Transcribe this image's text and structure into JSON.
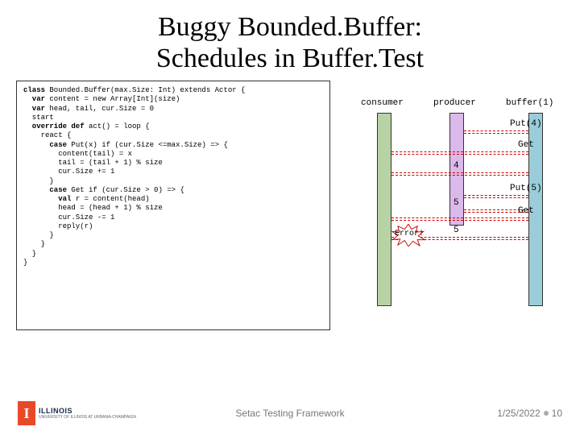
{
  "title_line1": "Buggy Bounded.Buffer:",
  "title_line2": "Schedules in Buffer.Test",
  "code": {
    "l1a": "class ",
    "l1b": "Bounded.Buffer(max.Size: Int) extends Actor {",
    "l2a": "  var ",
    "l2b": "content = new Array[Int](size)",
    "l3a": "  var ",
    "l3b": "head, tail, cur.Size = 0",
    "l4": "  start",
    "l5a": "  override def ",
    "l5b": "act() = loop {",
    "l6": "    react {",
    "l7a": "      case ",
    "l7b": "Put(x) if (cur.Size <=max.Size) => {",
    "l8": "        content(tail) = x",
    "l9": "        tail = (tail + 1) % size",
    "l10": "        cur.Size += 1",
    "l11": "      }",
    "l12a": "      case ",
    "l12b": "Get if (cur.Size > 0) => {",
    "l13a": "        val ",
    "l13b": "r = content(head)",
    "l14": "        head = (head + 1) % size",
    "l15": "        cur.Size -= 1",
    "l16": "        reply(r)",
    "l17": "      }",
    "l18": "    }",
    "l19": "  }",
    "l20": "}"
  },
  "diagram": {
    "headers": {
      "consumer": "consumer",
      "producer": "producer",
      "buffer": "buffer(1)"
    },
    "labels": {
      "put4": "Put(4)",
      "get1": "Get",
      "put5": "Put(5)",
      "get2": "Get",
      "v4": "4",
      "v5a": "5",
      "v5b": "5",
      "error": "Error!"
    }
  },
  "footer": {
    "center": "Setac Testing Framework",
    "date": "1/25/2022",
    "page": "10",
    "logo": "ILLINOIS",
    "logo_sub": "UNIVERSITY OF ILLINOIS AT URBANA-CHAMPAIGN"
  },
  "chart_data": {
    "type": "sequence-diagram",
    "actors": [
      "consumer",
      "producer",
      "buffer(1)"
    ],
    "messages": [
      {
        "from": "producer",
        "to": "buffer(1)",
        "label": "Put(4)"
      },
      {
        "from": "consumer",
        "to": "buffer(1)",
        "label": "Get"
      },
      {
        "from": "buffer(1)",
        "to": "consumer",
        "label": "4"
      },
      {
        "from": "producer",
        "to": "buffer(1)",
        "label": "Put(5)"
      },
      {
        "from": "buffer(1)",
        "to": "producer",
        "label": "5"
      },
      {
        "from": "consumer",
        "to": "buffer(1)",
        "label": "Get"
      },
      {
        "from": "buffer(1)",
        "to": "consumer",
        "label": "5",
        "note": "Error!"
      }
    ]
  }
}
